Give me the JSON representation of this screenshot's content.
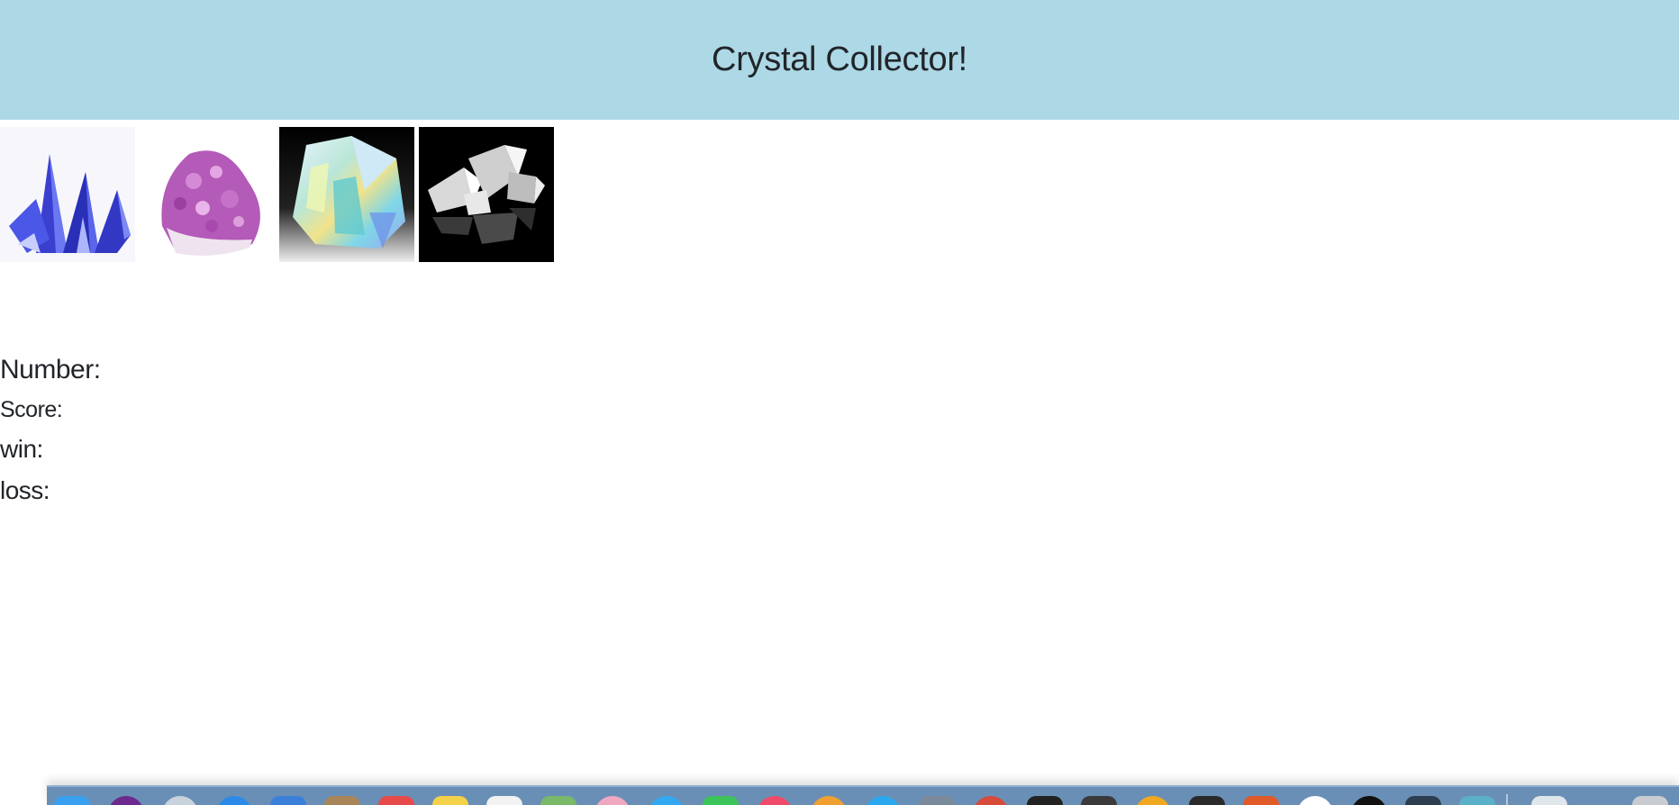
{
  "header": {
    "title": "Crystal Collector!"
  },
  "crystals": [
    {
      "name": "Blue crystal",
      "icon": "blue-crystal-icon"
    },
    {
      "name": "Purple amethyst crystal",
      "icon": "amethyst-crystal-icon"
    },
    {
      "name": "Aura quartz crystal",
      "icon": "aura-quartz-crystal-icon"
    },
    {
      "name": "Clear quartz crystal",
      "icon": "clear-quartz-crystal-icon"
    }
  ],
  "stats": {
    "number_label": "Number:",
    "number_value": "",
    "score_label": "Score:",
    "score_value": "",
    "win_label": "win:",
    "win_value": "",
    "loss_label": "loss:",
    "loss_value": ""
  },
  "colors": {
    "header_bg": "#add8e6",
    "text": "#212529",
    "dock": "#6a8fb6"
  }
}
